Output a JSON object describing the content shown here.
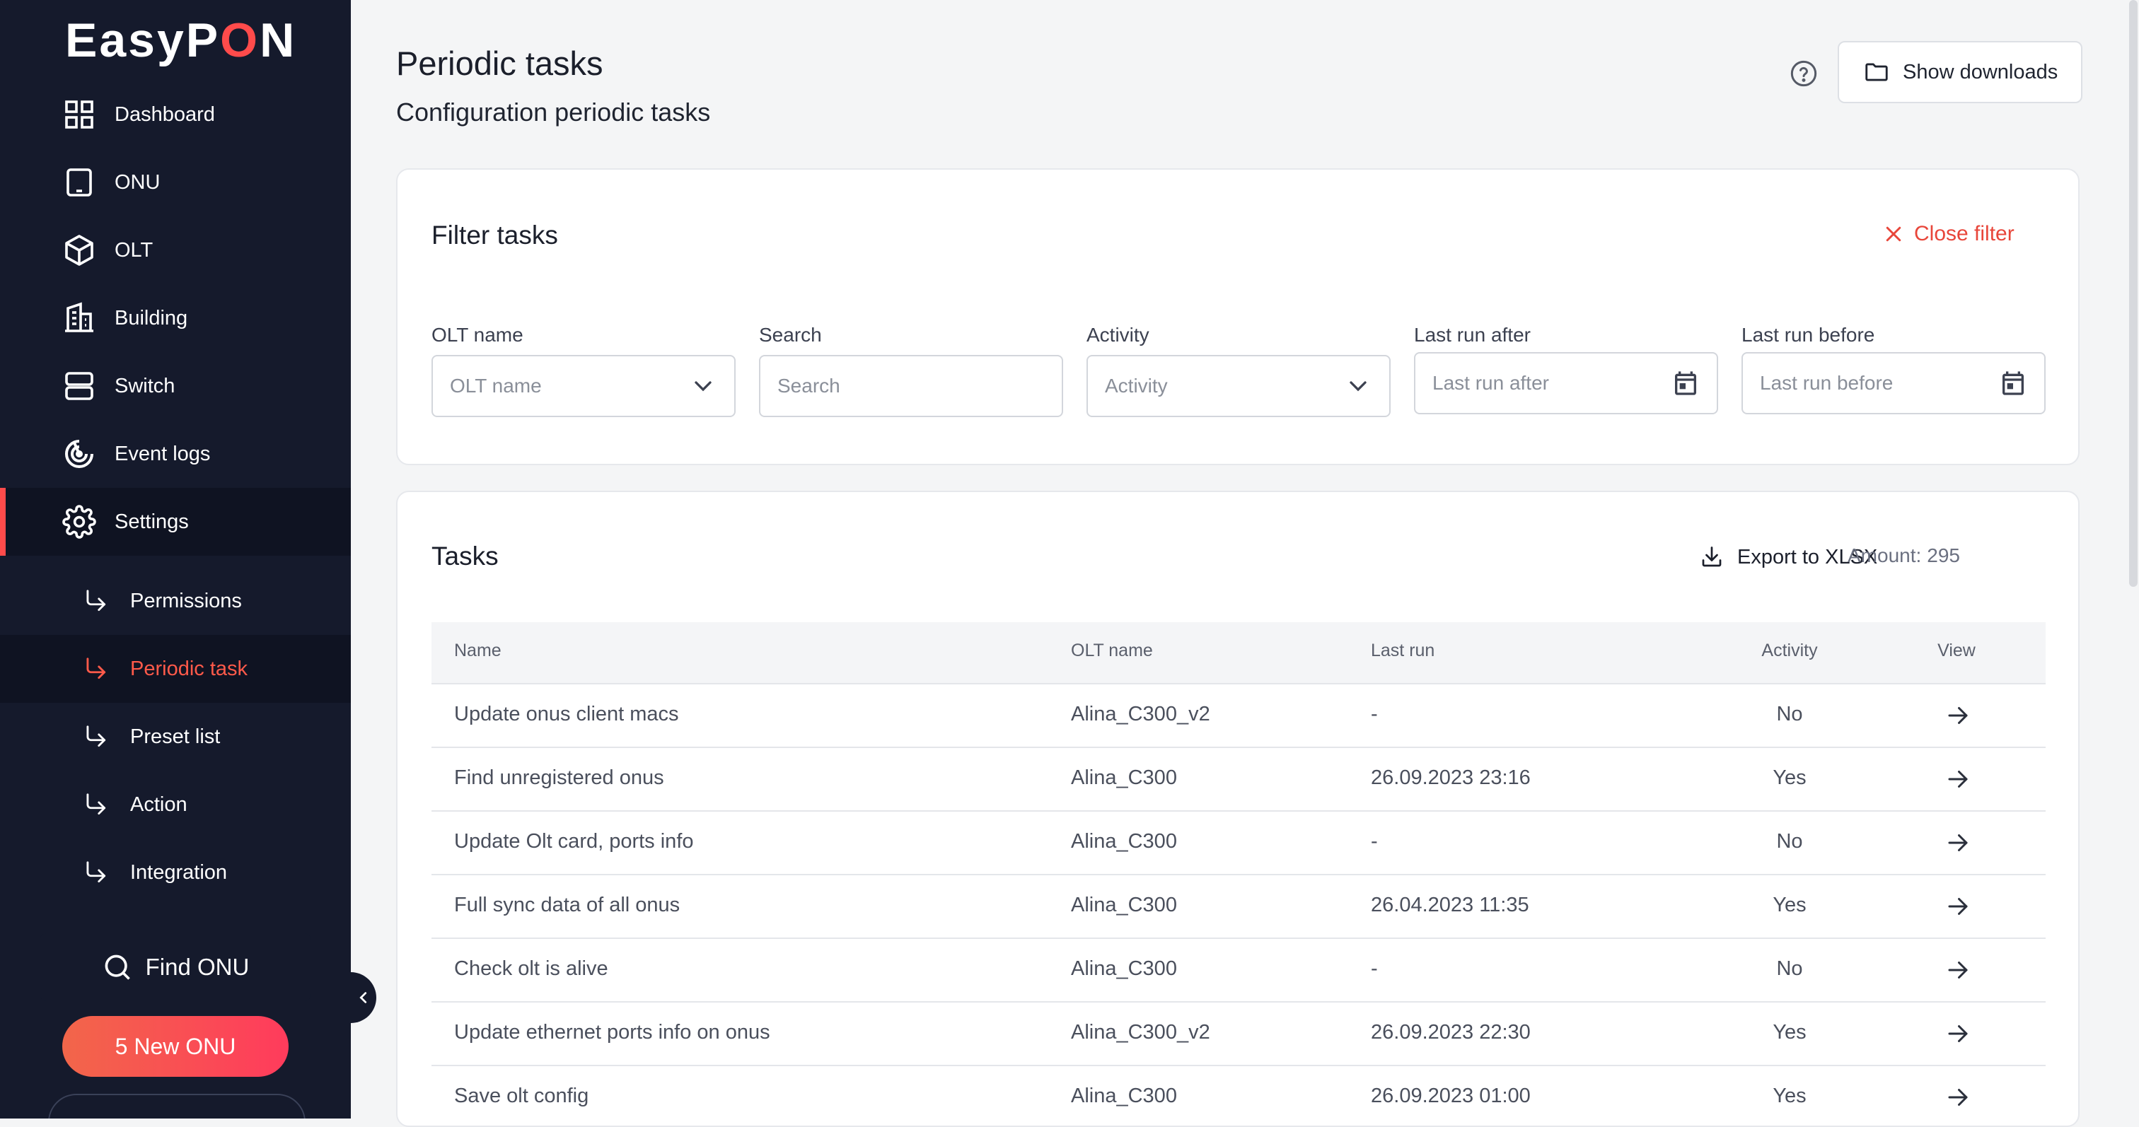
{
  "app": {
    "logo": {
      "prefix": "EasyP",
      "o": "O",
      "suffix": "N"
    }
  },
  "sidebar": {
    "items": [
      {
        "label": "Dashboard",
        "icon": "dashboard-grid-icon"
      },
      {
        "label": "ONU",
        "icon": "tablet-icon"
      },
      {
        "label": "OLT",
        "icon": "cube-icon"
      },
      {
        "label": "Building",
        "icon": "building-icon"
      },
      {
        "label": "Switch",
        "icon": "server-icon"
      },
      {
        "label": "Event logs",
        "icon": "radar-icon"
      },
      {
        "label": "Settings",
        "icon": "gear-icon",
        "active": true
      }
    ],
    "subitems": [
      {
        "label": "Permissions",
        "icon": "return-arrow-icon"
      },
      {
        "label": "Periodic task",
        "icon": "return-arrow-icon",
        "active": true
      },
      {
        "label": "Preset list",
        "icon": "return-arrow-icon"
      },
      {
        "label": "Action",
        "icon": "return-arrow-icon"
      },
      {
        "label": "Integration",
        "icon": "return-arrow-icon"
      }
    ],
    "find_onu": "Find ONU",
    "new_onu": "5 New ONU",
    "accent_color": "#ff4b4b"
  },
  "header": {
    "title": "Periodic tasks",
    "subtitle": "Configuration periodic tasks",
    "show_downloads": "Show downloads"
  },
  "filter": {
    "title": "Filter tasks",
    "close": "Close filter",
    "fields": {
      "olt_name": {
        "label": "OLT name",
        "placeholder": "OLT name"
      },
      "search": {
        "label": "Search",
        "placeholder": "Search"
      },
      "activity": {
        "label": "Activity",
        "placeholder": "Activity"
      },
      "last_run_after": {
        "label": "Last run after",
        "placeholder": "Last run after"
      },
      "last_run_before": {
        "label": "Last run before",
        "placeholder": "Last run before"
      }
    }
  },
  "tasks": {
    "title": "Tasks",
    "export": "Export to XLSX",
    "amount_label": "Amount:",
    "amount_value": "295",
    "columns": {
      "name": "Name",
      "olt": "OLT name",
      "last_run": "Last run",
      "activity": "Activity",
      "view": "View"
    },
    "rows": [
      {
        "name": "Update onus client macs",
        "olt": "Alina_C300_v2",
        "last_run": "-",
        "activity": "No"
      },
      {
        "name": "Find unregistered onus",
        "olt": "Alina_C300",
        "last_run": "26.09.2023 23:16",
        "activity": "Yes"
      },
      {
        "name": "Update Olt card, ports info",
        "olt": "Alina_C300",
        "last_run": "-",
        "activity": "No"
      },
      {
        "name": "Full sync data of all onus",
        "olt": "Alina_C300",
        "last_run": "26.04.2023 11:35",
        "activity": "Yes"
      },
      {
        "name": "Check olt is alive",
        "olt": "Alina_C300",
        "last_run": "-",
        "activity": "No"
      },
      {
        "name": "Update ethernet ports info on onus",
        "olt": "Alina_C300_v2",
        "last_run": "26.09.2023 22:30",
        "activity": "Yes"
      },
      {
        "name": "Save olt config",
        "olt": "Alina_C300",
        "last_run": "26.09.2023 01:00",
        "activity": "Yes"
      }
    ]
  }
}
